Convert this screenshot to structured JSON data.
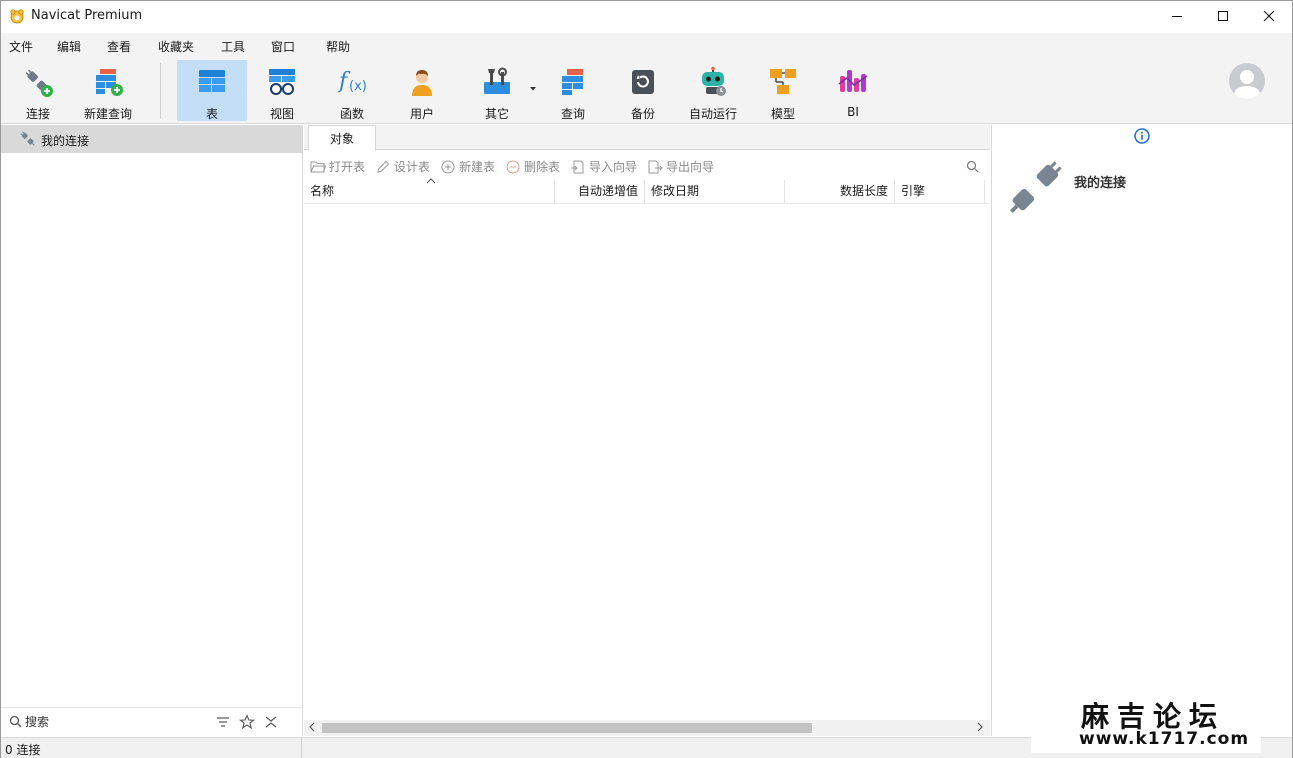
{
  "window": {
    "title": "Navicat Premium"
  },
  "menu": [
    "文件",
    "编辑",
    "查看",
    "收藏夹",
    "工具",
    "窗口",
    "帮助"
  ],
  "toolbar": {
    "items": [
      {
        "label": "连接",
        "icon": "plug-add-icon"
      },
      {
        "label": "新建查询",
        "icon": "new-query-icon"
      },
      {
        "label": "表",
        "icon": "table-icon",
        "active": true
      },
      {
        "label": "视图",
        "icon": "view-icon"
      },
      {
        "label": "函数",
        "icon": "function-icon"
      },
      {
        "label": "用户",
        "icon": "user-icon"
      },
      {
        "label": "其它",
        "icon": "tools-icon"
      },
      {
        "label": "查询",
        "icon": "query-icon"
      },
      {
        "label": "备份",
        "icon": "backup-icon"
      },
      {
        "label": "自动运行",
        "icon": "robot-icon"
      },
      {
        "label": "模型",
        "icon": "model-icon"
      },
      {
        "label": "BI",
        "icon": "bi-icon"
      }
    ],
    "active_color": "#c4def5"
  },
  "left": {
    "connection_group": "我的连接",
    "search_placeholder": "搜索"
  },
  "center": {
    "tab": "对象",
    "actions": [
      "打开表",
      "设计表",
      "新建表",
      "删除表",
      "导入向导",
      "导出向导"
    ],
    "columns": [
      "名称",
      "自动递增值",
      "修改日期",
      "数据长度",
      "引擎"
    ]
  },
  "right": {
    "title": "我的连接"
  },
  "status": {
    "connections": "0 连接"
  },
  "watermark": {
    "title": "麻吉论坛",
    "url": "www.k1717.com"
  }
}
